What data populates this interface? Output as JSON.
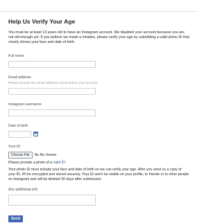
{
  "page": {
    "title": "Help Us Verify Your Age",
    "intro": "You must be at least 13 years old to have an Instagram account. We disabled your account because you are not old enough yet. If you believe we made a mistake, please verify your age by submitting a valid photo ID that clearly shows your face and date of birth."
  },
  "form": {
    "full_name_label": "Full name",
    "email_label": "Email address",
    "email_help": "Please provide the email address connected to your account.",
    "username_label": "Instagram username",
    "dob_label": "Date of birth",
    "id_label": "Your ID",
    "choose_file_label": "Choose File",
    "no_file_text": "No file chosen",
    "provide_text": "Please provide a photo of a",
    "provide_link": "valid ID",
    "provide_end": ".",
    "id_note": "Your photo ID must include your face and date of birth so we can verify your age. After you send us a copy of your ID, it'll be encrypted and stored securely. Your ID won't be visible on your profile, to friends or to other people on Instagram and will be deleted 30 days after submission.",
    "additional_label": "Any additional info",
    "send_label": "Send"
  },
  "colors": {
    "button": "#4267b2",
    "link": "#385898"
  }
}
